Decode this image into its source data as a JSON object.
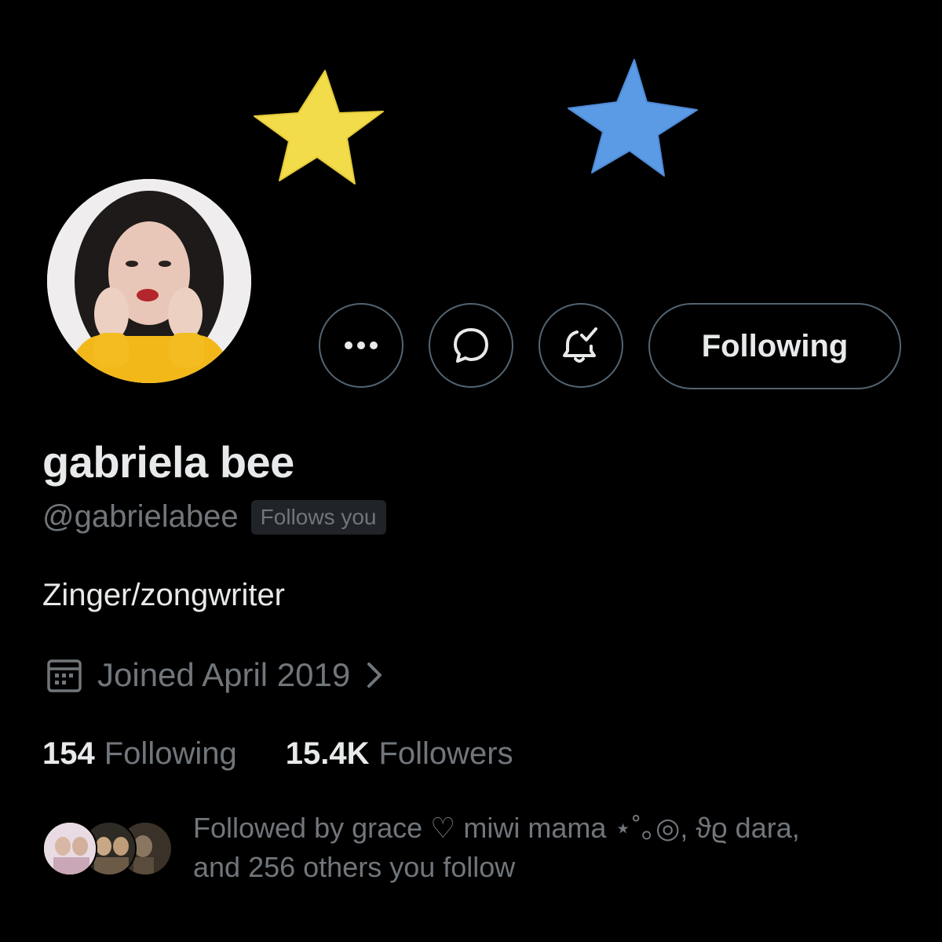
{
  "profile": {
    "display_name": "gabriela bee",
    "handle": "@gabrielabee",
    "follows_you_badge": "Follows you",
    "bio": "Zinger/zongwriter",
    "joined": "Joined April 2019"
  },
  "actions": {
    "more_icon": "more-dots-icon",
    "message_icon": "message-bubble-icon",
    "notifications_icon": "bell-check-icon",
    "follow_label": "Following"
  },
  "stats": {
    "following_count": "154",
    "following_label": "Following",
    "followers_count": "15.4K",
    "followers_label": "Followers"
  },
  "followed_by": {
    "line1": "Followed by grace ♡ miwi mama ⋆˚｡◎, ϑϱ dara,",
    "line2": "and 256 others you follow"
  },
  "colors": {
    "background": "#000000",
    "text_primary": "#e7e9ea",
    "text_secondary": "#71767b",
    "border": "#536471",
    "badge_bg": "#202327",
    "star_yellow": "#f2dc4a",
    "star_blue": "#5b9be6"
  }
}
